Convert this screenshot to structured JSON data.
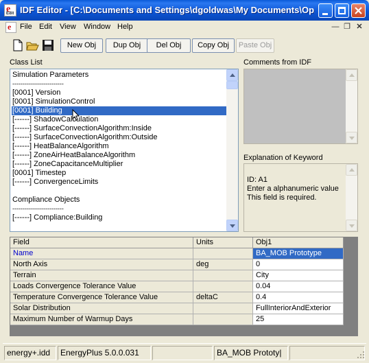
{
  "window": {
    "title": "IDF Editor - [C:\\Documents and Settings\\dgoldwas\\My Documents\\Op..."
  },
  "menu": {
    "items": [
      "File",
      "Edit",
      "View",
      "Window",
      "Help"
    ]
  },
  "toolbar": {
    "icons": [
      "new-file-icon",
      "open-folder-icon",
      "save-disk-icon"
    ],
    "buttons": {
      "new_obj": "New Obj",
      "dup_obj": "Dup Obj",
      "del_obj": "Del Obj",
      "copy_obj": "Copy Obj",
      "paste_obj": "Paste Obj"
    },
    "paste_enabled": false
  },
  "class_list": {
    "label": "Class List",
    "rows": [
      "Simulation Parameters",
      "-------------------------",
      "[0001]  Version",
      "[0001]  SimulationControl",
      "[0001]  Building",
      "[------]  ShadowCalculation",
      "[------]  SurfaceConvectionAlgorithm:Inside",
      "[------]  SurfaceConvectionAlgorithm:Outside",
      "[------]  HeatBalanceAlgorithm",
      "[------]  ZoneAirHeatBalanceAlgorithm",
      "[------]  ZoneCapacitanceMultiplier",
      "[0001]  Timestep",
      "[------]  ConvergenceLimits",
      "",
      "Compliance Objects",
      "-------------------------",
      "[------]  Compliance:Building"
    ],
    "selected_index": 4
  },
  "comments": {
    "label": "Comments from IDF",
    "text": ""
  },
  "explanation": {
    "label": "Explanation of Keyword",
    "lines": [
      "ID: A1",
      "Enter a alphanumeric value",
      "This field is required."
    ]
  },
  "grid": {
    "headers": {
      "field": "Field",
      "units": "Units",
      "obj": "Obj1"
    },
    "rows": [
      {
        "field": "Name",
        "units": "",
        "value": "BA_MOB Prototype"
      },
      {
        "field": "North Axis",
        "units": "deg",
        "value": "0"
      },
      {
        "field": "Terrain",
        "units": "",
        "value": "City"
      },
      {
        "field": "Loads Convergence Tolerance Value",
        "units": "",
        "value": "0.04"
      },
      {
        "field": "Temperature Convergence Tolerance Value",
        "units": "deltaC",
        "value": "0.4"
      },
      {
        "field": "Solar Distribution",
        "units": "",
        "value": "FullInteriorAndExterior"
      },
      {
        "field": "Maximum Number of Warmup Days",
        "units": "",
        "value": "25"
      }
    ],
    "selected_row": 0
  },
  "statusbar": {
    "panels": [
      "energy+.idd",
      "EnergyPlus 5.0.0.031",
      "",
      "BA_MOB Prototy|"
    ]
  },
  "colors": {
    "selection": "#316ac5",
    "titlebar": "#0a5ad8",
    "close_button": "#c8421e",
    "link_field": "#0000cc"
  }
}
